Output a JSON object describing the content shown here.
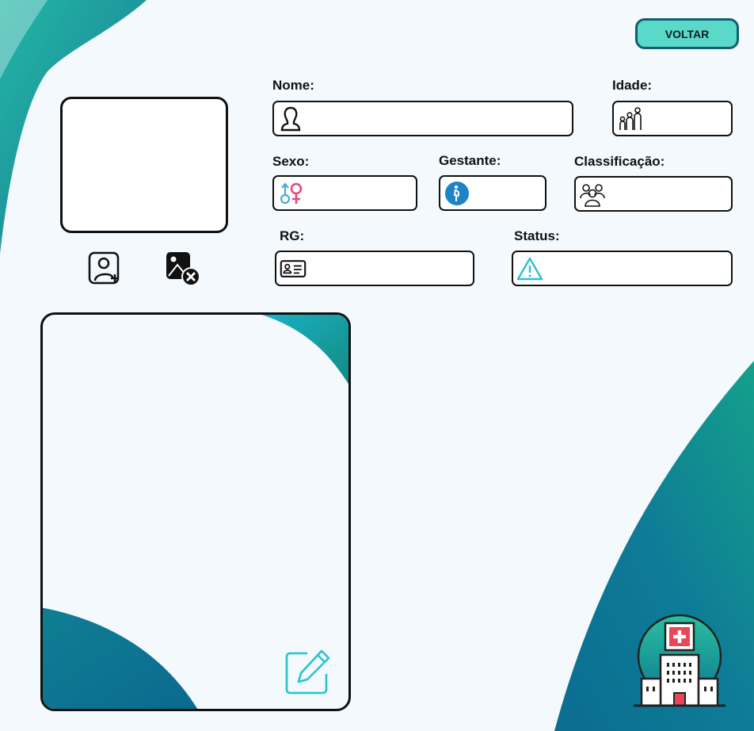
{
  "header": {
    "back_button": "VOLTAR"
  },
  "photo": {
    "add_icon": "add-user-icon",
    "remove_icon": "remove-image-icon"
  },
  "form": {
    "nome": {
      "label": "Nome:",
      "value": "",
      "icon": "person-icon"
    },
    "idade": {
      "label": "Idade:",
      "value": "",
      "icon": "family-age-icon"
    },
    "sexo": {
      "label": "Sexo:",
      "value": "",
      "icon": "gender-icon"
    },
    "gestante": {
      "label": "Gestante:",
      "value": "",
      "icon": "pregnant-icon"
    },
    "classificacao": {
      "label": "Classificação:",
      "value": "",
      "icon": "group-icon"
    },
    "rg": {
      "label": "RG:",
      "value": "",
      "icon": "id-card-icon"
    },
    "status": {
      "label": "Status:",
      "value": "",
      "icon": "warning-icon"
    }
  },
  "notes": {
    "value": "",
    "edit_icon": "edit-icon"
  },
  "colors": {
    "accent": "#5ad8c9",
    "accent_border": "#0f5f70",
    "teal_dark": "#0d6e86",
    "teal_green": "#16a085",
    "female": "#e8477a",
    "male": "#4aa8d8"
  },
  "logo_icon": "hospital-icon"
}
